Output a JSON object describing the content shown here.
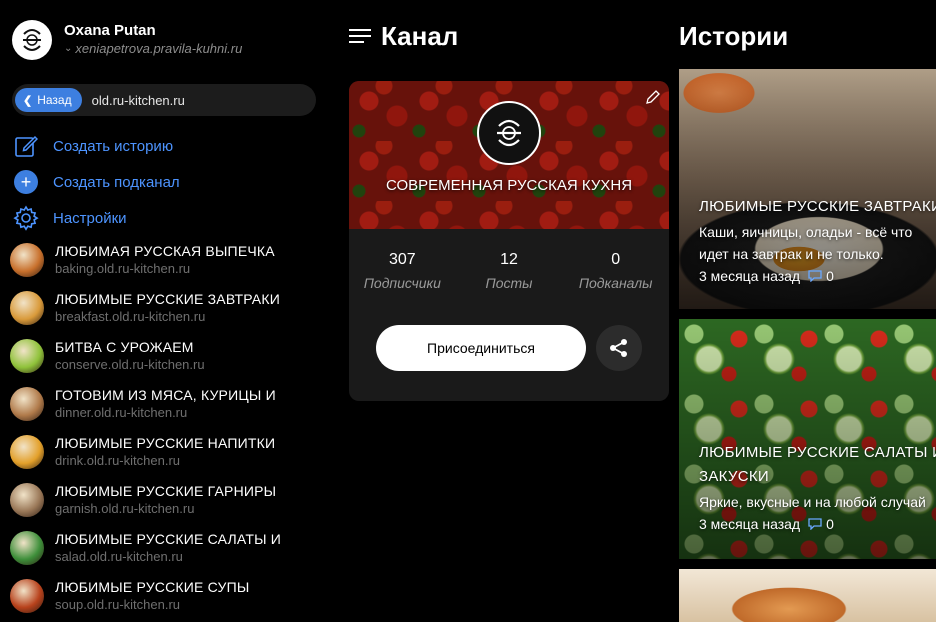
{
  "user": {
    "name": "Oxana Putan",
    "site": "xeniapetrova.pravila-kuhni.ru",
    "logo_icon": "kitchen-logo-icon"
  },
  "urlbar": {
    "back_label": "Назад",
    "url": "old.ru-kitchen.ru"
  },
  "actions": [
    {
      "label": "Создать историю",
      "icon": "create-story-icon"
    },
    {
      "label": "Создать подканал",
      "icon": "plus-circle-icon"
    },
    {
      "label": "Настройки",
      "icon": "gear-icon"
    }
  ],
  "subchannels": [
    {
      "title": "ЛЮБИМАЯ РУССКАЯ ВЫПЕЧКА",
      "url": "baking.old.ru-kitchen.ru",
      "color": "#c8702c"
    },
    {
      "title": "ЛЮБИМЫЕ РУССКИЕ ЗАВТРАКИ",
      "url": "breakfast.old.ru-kitchen.ru",
      "color": "#d99a3a"
    },
    {
      "title": "БИТВА С УРОЖАЕМ",
      "url": "conserve.old.ru-kitchen.ru",
      "color": "#8fc23a"
    },
    {
      "title": "ГОТОВИМ ИЗ МЯСА, КУРИЦЫ И",
      "url": "dinner.old.ru-kitchen.ru",
      "color": "#b07a4a"
    },
    {
      "title": "ЛЮБИМЫЕ РУССКИЕ НАПИТКИ",
      "url": "drink.old.ru-kitchen.ru",
      "color": "#e3a02a"
    },
    {
      "title": "ЛЮБИМЫЕ РУССКИЕ ГАРНИРЫ",
      "url": "garnish.old.ru-kitchen.ru",
      "color": "#9a7858"
    },
    {
      "title": "ЛЮБИМЫЕ РУССКИЕ САЛАТЫ И",
      "url": "salad.old.ru-kitchen.ru",
      "color": "#3e8f3a"
    },
    {
      "title": "ЛЮБИМЫЕ РУССКИЕ СУПЫ",
      "url": "soup.old.ru-kitchen.ru",
      "color": "#b8421c"
    }
  ],
  "channel": {
    "heading": "Канал",
    "cover_title": "СОВРЕМЕННАЯ РУССКАЯ КУХНЯ",
    "stats": [
      {
        "value": "307",
        "label": "Подписчики"
      },
      {
        "value": "12",
        "label": "Посты"
      },
      {
        "value": "0",
        "label": "Подканалы"
      }
    ],
    "join_label": "Присоединиться"
  },
  "stories": {
    "heading": "Истории",
    "items": [
      {
        "title_lines": [
          "ЛЮБИМЫЕ РУССКИЕ ЗАВТРАКИ"
        ],
        "desc_lines": [
          "Каши, яичницы, оладьи - всё что",
          "идет на завтрак и не только."
        ],
        "time": "3 месяца назад",
        "comments": "0"
      },
      {
        "title_lines": [
          "ЛЮБИМЫЕ РУССКИЕ САЛАТЫ И",
          "ЗАКУСКИ"
        ],
        "desc_lines": [
          "Яркие, вкусные и на любой случай"
        ],
        "time": "3 месяца назад",
        "comments": "0"
      }
    ]
  }
}
